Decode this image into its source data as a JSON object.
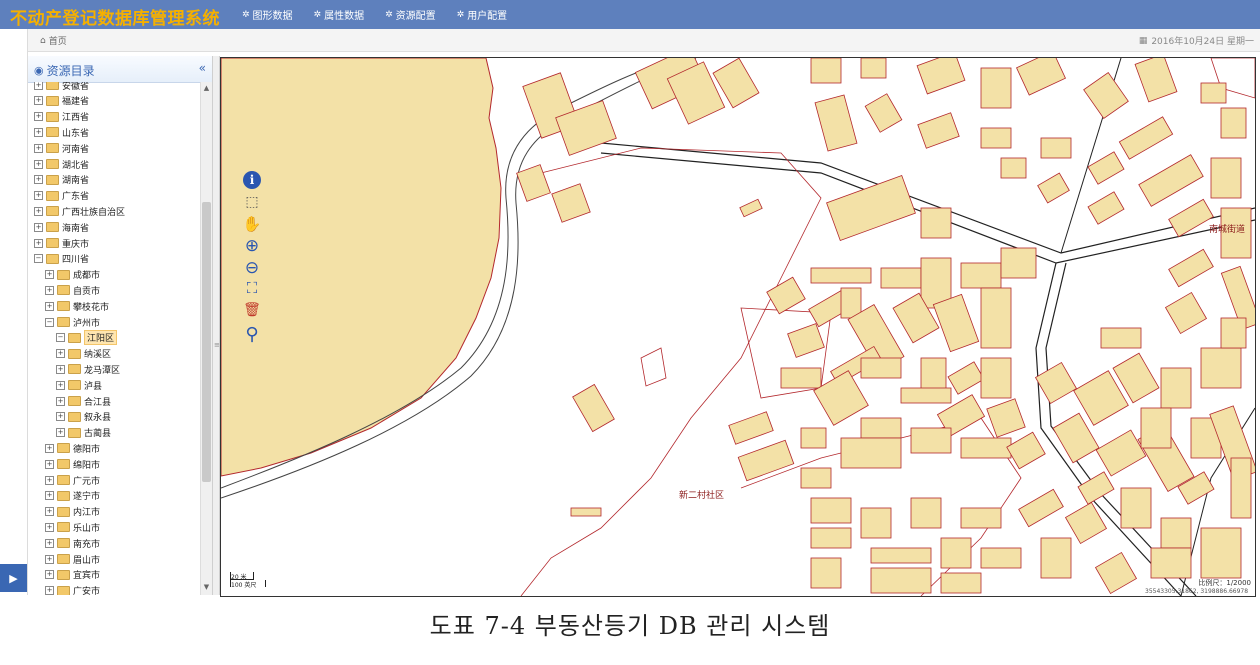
{
  "app": {
    "title": "不动产登记数据库管理系统"
  },
  "nav": [
    {
      "label": "图形数据",
      "icon": "gears-icon"
    },
    {
      "label": "属性数据",
      "icon": "gears-icon"
    },
    {
      "label": "资源配置",
      "icon": "gears-icon"
    },
    {
      "label": "用户配置",
      "icon": "gears-icon"
    }
  ],
  "breadcrumb": {
    "label": "首页"
  },
  "date": "2016年10月24日 星期一",
  "sidebar": {
    "title": "资源目录",
    "collapse_icon": "double-chevron-left-icon",
    "tree": [
      {
        "label": "安徽省",
        "level": 0,
        "expanded": false
      },
      {
        "label": "福建省",
        "level": 0,
        "expanded": false
      },
      {
        "label": "江西省",
        "level": 0,
        "expanded": false
      },
      {
        "label": "山东省",
        "level": 0,
        "expanded": false
      },
      {
        "label": "河南省",
        "level": 0,
        "expanded": false
      },
      {
        "label": "湖北省",
        "level": 0,
        "expanded": false
      },
      {
        "label": "湖南省",
        "level": 0,
        "expanded": false
      },
      {
        "label": "广东省",
        "level": 0,
        "expanded": false
      },
      {
        "label": "广西壮族自治区",
        "level": 0,
        "expanded": false
      },
      {
        "label": "海南省",
        "level": 0,
        "expanded": false
      },
      {
        "label": "重庆市",
        "level": 0,
        "expanded": false
      },
      {
        "label": "四川省",
        "level": 0,
        "expanded": true
      },
      {
        "label": "成都市",
        "level": 1,
        "expanded": false
      },
      {
        "label": "自贡市",
        "level": 1,
        "expanded": false
      },
      {
        "label": "攀枝花市",
        "level": 1,
        "expanded": false
      },
      {
        "label": "泸州市",
        "level": 1,
        "expanded": true
      },
      {
        "label": "江阳区",
        "level": 2,
        "expanded": true,
        "selected": true
      },
      {
        "label": "纳溪区",
        "level": 2,
        "expanded": false
      },
      {
        "label": "龙马潭区",
        "level": 2,
        "expanded": false
      },
      {
        "label": "泸县",
        "level": 2,
        "expanded": false
      },
      {
        "label": "合江县",
        "level": 2,
        "expanded": false
      },
      {
        "label": "叙永县",
        "level": 2,
        "expanded": false
      },
      {
        "label": "古蔺县",
        "level": 2,
        "expanded": false
      },
      {
        "label": "德阳市",
        "level": 1,
        "expanded": false
      },
      {
        "label": "绵阳市",
        "level": 1,
        "expanded": false
      },
      {
        "label": "广元市",
        "level": 1,
        "expanded": false
      },
      {
        "label": "遂宁市",
        "level": 1,
        "expanded": false
      },
      {
        "label": "内江市",
        "level": 1,
        "expanded": false
      },
      {
        "label": "乐山市",
        "level": 1,
        "expanded": false
      },
      {
        "label": "南充市",
        "level": 1,
        "expanded": false
      },
      {
        "label": "眉山市",
        "level": 1,
        "expanded": false
      },
      {
        "label": "宜宾市",
        "level": 1,
        "expanded": false
      },
      {
        "label": "广安市",
        "level": 1,
        "expanded": false
      }
    ]
  },
  "map": {
    "tools": [
      {
        "name": "info-icon",
        "glyph": "i"
      },
      {
        "name": "select-icon",
        "glyph": "⬚"
      },
      {
        "name": "pan-hand-icon",
        "glyph": "✋"
      },
      {
        "name": "zoom-in-icon",
        "glyph": "⊕"
      },
      {
        "name": "zoom-out-icon",
        "glyph": "⊖"
      },
      {
        "name": "full-extent-icon",
        "glyph": "⛶"
      },
      {
        "name": "clear-trash-icon",
        "glyph": "🗑"
      },
      {
        "name": "search-icon",
        "glyph": "⚲"
      }
    ],
    "labels": [
      {
        "text": "新二村社区"
      },
      {
        "text": "南城街道"
      }
    ],
    "scale_top": "20 米",
    "scale_bottom": "100 英尺",
    "scale_readout": "比例尺：1/2000",
    "coord_readout": "35543305.31862, 3198886.66978"
  },
  "colors": {
    "topbar": "#5e80bd",
    "title": "#f5b000",
    "building_fill": "#f3e1a7",
    "parcel_line": "#b3282d",
    "road_line": "#222222"
  },
  "caption": "도표 7-4 부동산등기 DB 관리 시스템"
}
